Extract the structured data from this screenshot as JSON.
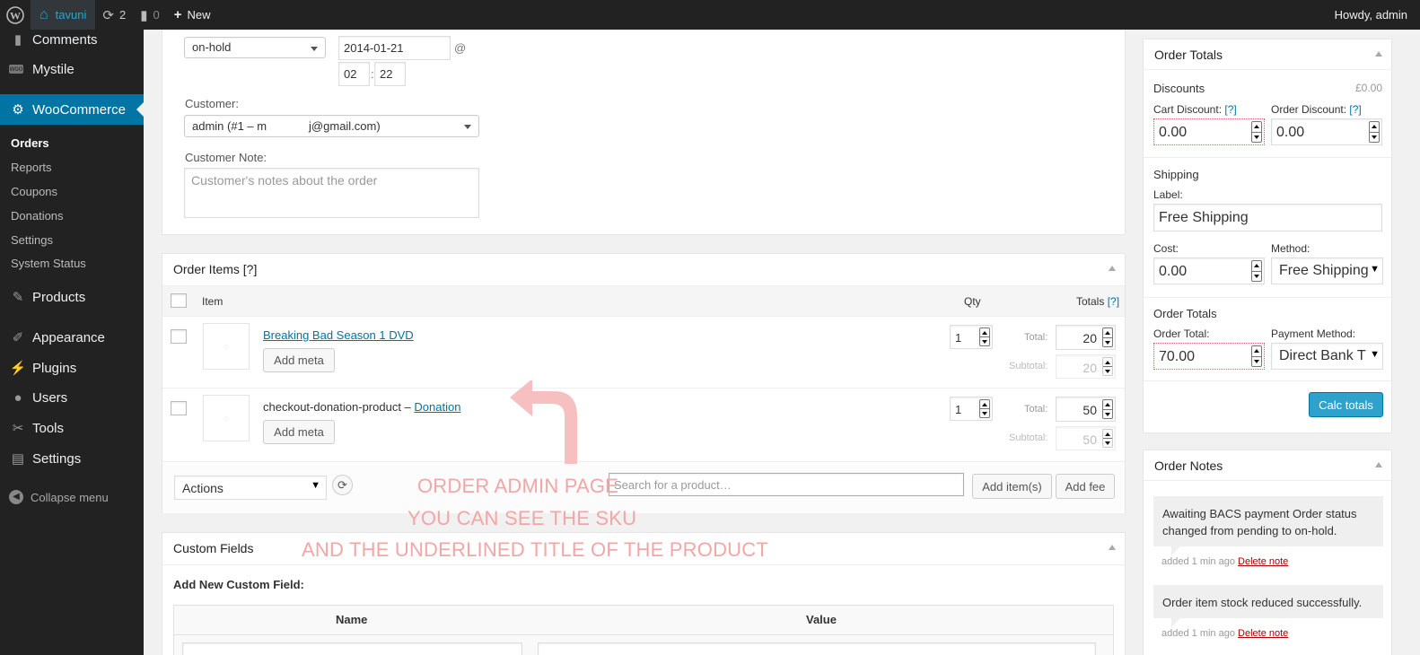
{
  "admin_bar": {
    "wp_icon": "wordpress-logo-icon",
    "site_name": "tavuni",
    "updates_count": "2",
    "comments_count": "0",
    "new_label": "New",
    "howdy": "Howdy, admin"
  },
  "sidebar": {
    "items": [
      {
        "label": "Comments",
        "icon": "comment-icon"
      },
      {
        "label": "Mystile",
        "icon": "woo-icon"
      },
      {
        "label": "WooCommerce",
        "icon": "gear-icon"
      },
      {
        "label": "Products",
        "icon": "pin-icon"
      },
      {
        "label": "Appearance",
        "icon": "brush-icon"
      },
      {
        "label": "Plugins",
        "icon": "plug-icon"
      },
      {
        "label": "Users",
        "icon": "user-icon"
      },
      {
        "label": "Tools",
        "icon": "wrench-icon"
      },
      {
        "label": "Settings",
        "icon": "settings-icon"
      }
    ],
    "submenu": [
      "Orders",
      "Reports",
      "Coupons",
      "Donations",
      "Settings",
      "System Status"
    ],
    "collapse": "Collapse menu"
  },
  "order_data": {
    "status": "on-hold",
    "date": "2014-01-21",
    "at": "@",
    "hour": "02",
    "colon": ":",
    "minute": "22",
    "customer_label": "Customer:",
    "customer_value": "admin (#1 – m             j@gmail.com)",
    "note_label": "Customer Note:",
    "note_placeholder": "Customer's notes about the order"
  },
  "order_items": {
    "title": "Order Items [?]",
    "col_item": "Item",
    "col_qty": "Qty",
    "col_totals": "Totals",
    "col_totals_help": "[?]",
    "rows": [
      {
        "name": "Breaking Bad Season 1 DVD",
        "prefix": "",
        "qty": "1",
        "total_label": "Total:",
        "total": "20",
        "subtotal_label": "Subtotal:",
        "subtotal": "20",
        "add_meta": "Add meta"
      },
      {
        "name": "Donation",
        "prefix": "checkout-donation-product – ",
        "qty": "1",
        "total_label": "Total:",
        "total": "50",
        "subtotal_label": "Subtotal:",
        "subtotal": "50",
        "add_meta": "Add meta"
      }
    ],
    "actions": "Actions",
    "search_placeholder": "Search for a product…",
    "add_items": "Add item(s)",
    "add_fee": "Add fee"
  },
  "custom_fields": {
    "title": "Custom Fields",
    "add_new": "Add New Custom Field:",
    "col_name": "Name",
    "col_value": "Value"
  },
  "annotation": {
    "line1": "ORDER ADMIN PAGE",
    "line2": "YOU CAN SEE THE SKU",
    "line3": "AND THE UNDERLINED TITLE OF THE PRODUCT",
    "color": "#f2a6a6"
  },
  "order_totals": {
    "title": "Order Totals",
    "discounts": "Discounts",
    "discounts_value": "£0.00",
    "cart_discount_label": "Cart Discount:",
    "cart_discount_help": "[?]",
    "cart_discount": "0.00",
    "order_discount_label": "Order Discount:",
    "order_discount_help": "[?]",
    "order_discount": "0.00",
    "shipping": "Shipping",
    "label_label": "Label:",
    "shipping_label": "Free Shipping",
    "cost_label": "Cost:",
    "cost": "0.00",
    "method_label": "Method:",
    "method": "Free Shipping",
    "order_totals_heading": "Order Totals",
    "order_total_label": "Order Total:",
    "order_total": "70.00",
    "payment_method_label": "Payment Method:",
    "payment_method": "Direct Bank T",
    "calc_button": "Calc totals",
    "accent": "#2ea2cc"
  },
  "order_notes": {
    "title": "Order Notes",
    "notes": [
      {
        "text": "Awaiting BACS payment Order status changed from pending to on-hold.",
        "meta": "added 1 min ago",
        "delete": "Delete note"
      },
      {
        "text": "Order item stock reduced successfully.",
        "meta": "added 1 min ago",
        "delete": "Delete note"
      }
    ]
  }
}
